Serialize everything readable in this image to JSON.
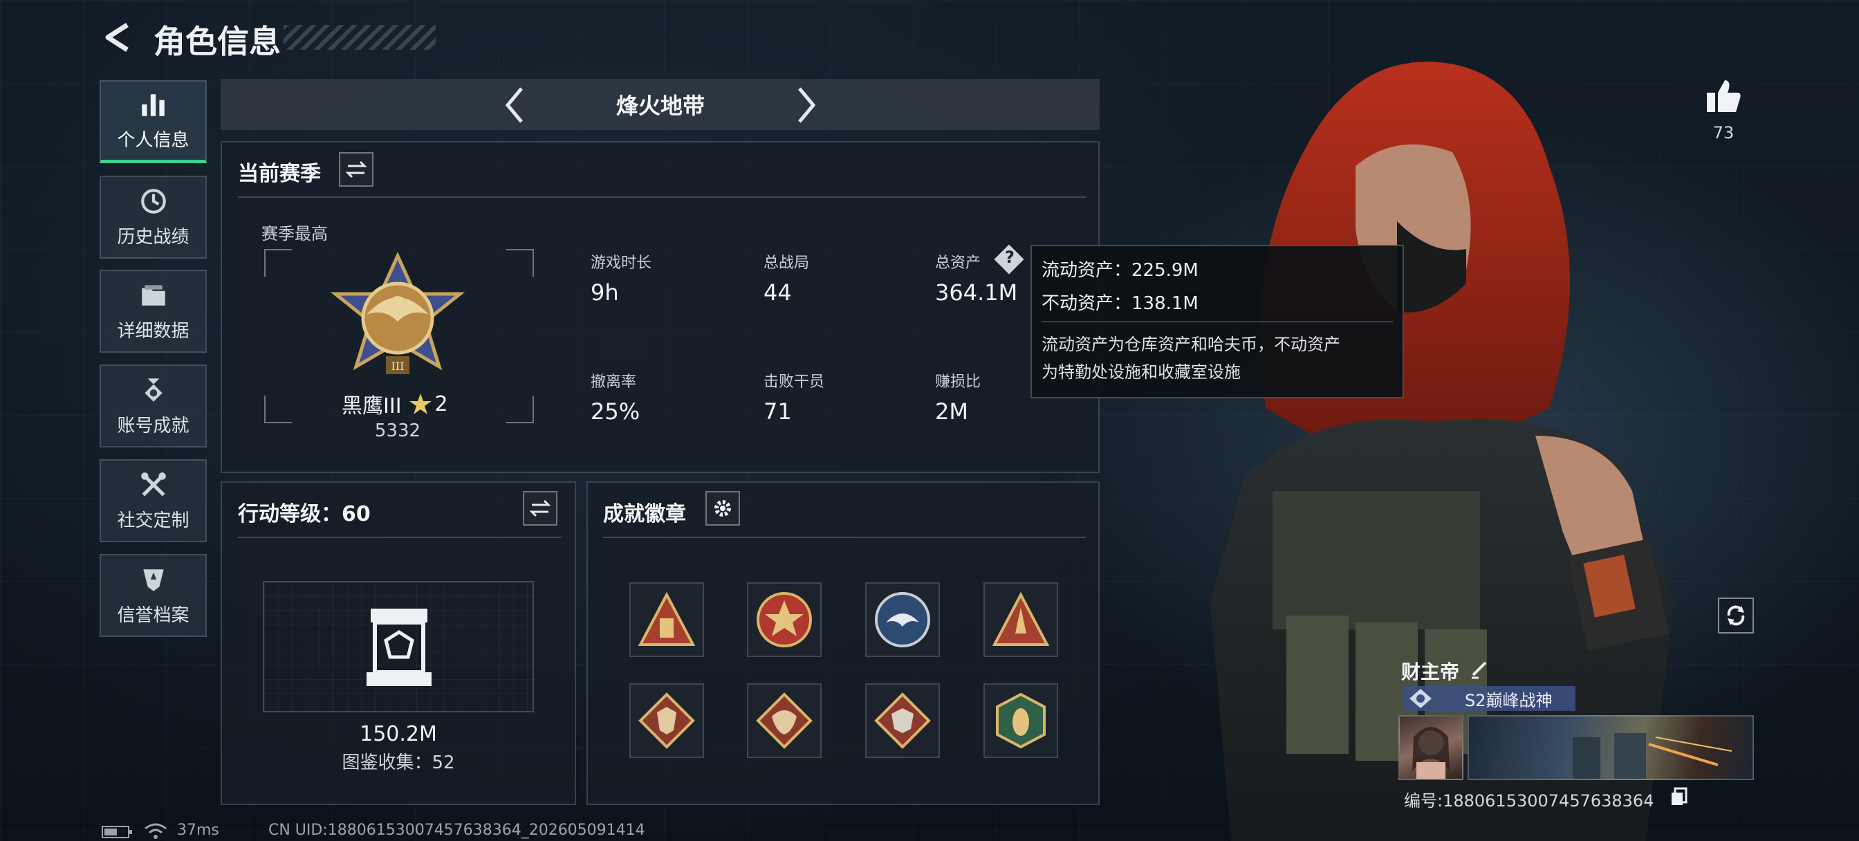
{
  "header": {
    "title": "角色信息"
  },
  "nav": {
    "items": [
      {
        "label": "个人信息",
        "active": true
      },
      {
        "label": "历史战绩"
      },
      {
        "label": "详细数据"
      },
      {
        "label": "账号成就"
      },
      {
        "label": "社交定制"
      },
      {
        "label": "信誉档案"
      }
    ]
  },
  "mode": {
    "title": "烽火地带"
  },
  "season": {
    "title": "当前赛季",
    "best_label": "赛季最高",
    "rank_name": "黑鹰III",
    "rank_stars": "2",
    "rank_score": "5332",
    "stats": [
      {
        "label": "游戏时长",
        "value": "9h"
      },
      {
        "label": "总战局",
        "value": "44"
      },
      {
        "label": "总资产",
        "value": "364.1M"
      },
      {
        "label": "撤离率",
        "value": "25%"
      },
      {
        "label": "击败干员",
        "value": "71"
      },
      {
        "label": "赚损比",
        "value": "2M"
      }
    ]
  },
  "tooltip": {
    "line1": "流动资产：225.9M",
    "line2": "不动资产：138.1M",
    "desc1": "流动资产为仓库资产和哈夫币，不动资产",
    "desc2": "为特勤处设施和收藏室设施"
  },
  "action_level": {
    "title": "行动等级：60",
    "value": "150.2M",
    "collection": "图鉴收集：52"
  },
  "achievements": {
    "title": "成就徽章",
    "badges": [
      {
        "icon": "triangle-supply-badge",
        "color": "#a5402e"
      },
      {
        "icon": "star-shield-badge",
        "color": "#b0382e"
      },
      {
        "icon": "eagle-round-badge",
        "color": "#2c4a72"
      },
      {
        "icon": "triangle-rocket-badge",
        "color": "#a5402e"
      },
      {
        "icon": "wolf-diamond-badge",
        "color": "#8a3a2c"
      },
      {
        "icon": "dragon-diamond-badge",
        "color": "#8a3a2c"
      },
      {
        "icon": "beast-diamond-badge",
        "color": "#8a3a2c"
      },
      {
        "icon": "hornet-hex-badge",
        "color": "#2f6048"
      }
    ]
  },
  "likes": {
    "count": "73"
  },
  "profile": {
    "name": "财主帝",
    "title": "S2巅峰战神",
    "id_text": "编号:18806153007457638364"
  },
  "status": {
    "ping": "37ms",
    "uid": "CN UID:18806153007457638364_202605091414"
  }
}
